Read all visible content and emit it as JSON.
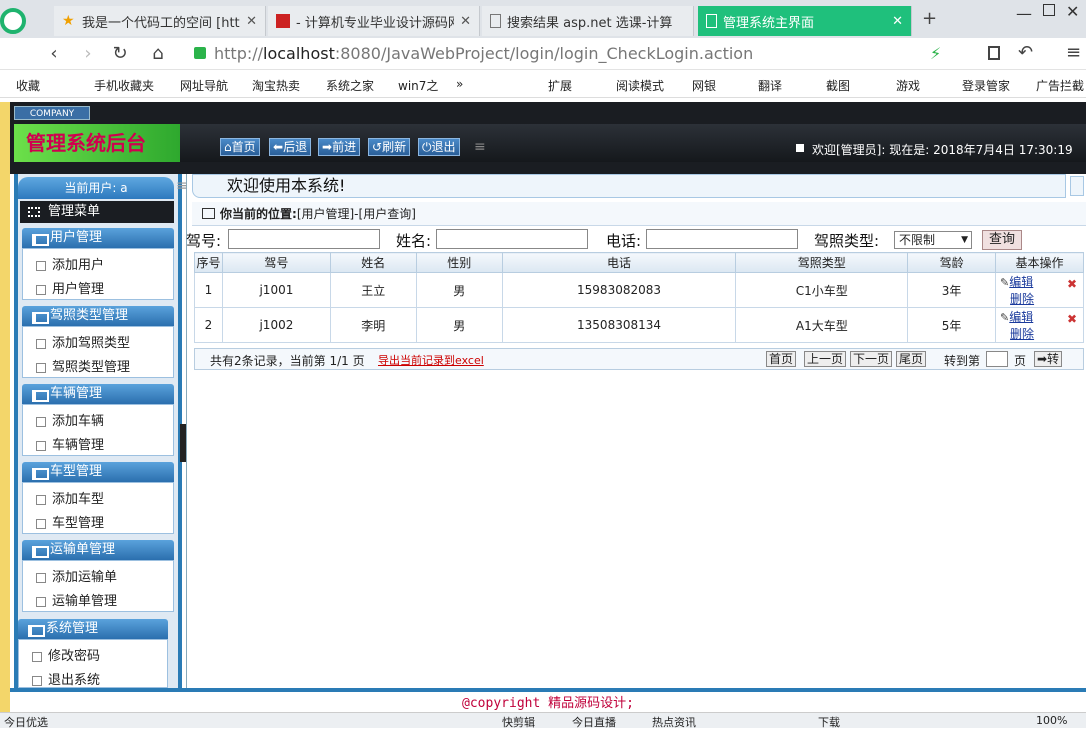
{
  "browser": {
    "tabs": [
      {
        "title": "我是一个代码工的空间 [http:"
      },
      {
        "title": "- 计算机专业毕业设计源码网"
      },
      {
        "title": "搜索结果 asp.net 选课-计算"
      },
      {
        "title": "管理系统主界面"
      }
    ],
    "url_prefix": "http://",
    "url_host": "localhost",
    "url_rest": ":8080/JavaWebProject/login/login_CheckLogin.action",
    "bookmarks": [
      "收藏",
      "手机收藏夹",
      "网址导航",
      "淘宝热卖",
      "系统之家",
      "win7之",
      "»",
      "扩展",
      "阅读模式",
      "网银",
      "翻译",
      "截图",
      "游戏",
      "登录管家",
      "广告拦截"
    ],
    "status_left": "今日优选",
    "status_items": [
      "快剪辑",
      "今日直播",
      "热点资讯",
      "下载",
      "100%"
    ]
  },
  "header": {
    "company": "COMPANY",
    "brand": "管理系统后台",
    "buttons": [
      "首页",
      "后退",
      "前进",
      "刷新",
      "退出"
    ],
    "welcome": "欢迎[管理员]:  现在是: 2018年7月4日 17:30:19"
  },
  "sidebar": {
    "current_user": "当前用户: a",
    "menu_title": "管理菜单",
    "groups": [
      {
        "title": "用户管理",
        "items": [
          "添加用户",
          "用户管理"
        ]
      },
      {
        "title": "驾照类型管理",
        "items": [
          "添加驾照类型",
          "驾照类型管理"
        ]
      },
      {
        "title": "车辆管理",
        "items": [
          "添加车辆",
          "车辆管理"
        ]
      },
      {
        "title": "车型管理",
        "items": [
          "添加车型",
          "车型管理"
        ]
      },
      {
        "title": "运输单管理",
        "items": [
          "添加运输单",
          "运输单管理"
        ]
      },
      {
        "title": "系统管理",
        "items": [
          "修改密码",
          "退出系统"
        ]
      }
    ]
  },
  "main": {
    "welcome": "欢迎使用本系统!",
    "position_label": "你当前的位置:",
    "position_path": "[用户管理]-[用户查询]",
    "search": {
      "labels": [
        "驾号:",
        "姓名:",
        "电话:",
        "驾照类型:"
      ],
      "select_value": "不限制",
      "query_button": "查询"
    },
    "table": {
      "headers": [
        "序号",
        "驾号",
        "姓名",
        "性别",
        "电话",
        "驾照类型",
        "驾龄",
        "基本操作"
      ],
      "rows": [
        [
          "1",
          "j1001",
          "王立",
          "男",
          "15983082083",
          "C1小车型",
          "3年"
        ],
        [
          "2",
          "j1002",
          "李明",
          "男",
          "13508308134",
          "A1大车型",
          "5年"
        ]
      ],
      "edit_label": "编辑",
      "delete_label": "删除"
    },
    "pager": {
      "summary": "共有2条记录，当前第 1/1 页",
      "export": "导出当前记录到excel",
      "buttons": [
        "首页",
        "上一页",
        "下一页",
        "尾页"
      ],
      "goto_label": "转到第",
      "page_label": "页",
      "go_button": "➡转"
    }
  },
  "footer": {
    "copyright": "@copyright 精品源码设计;"
  }
}
